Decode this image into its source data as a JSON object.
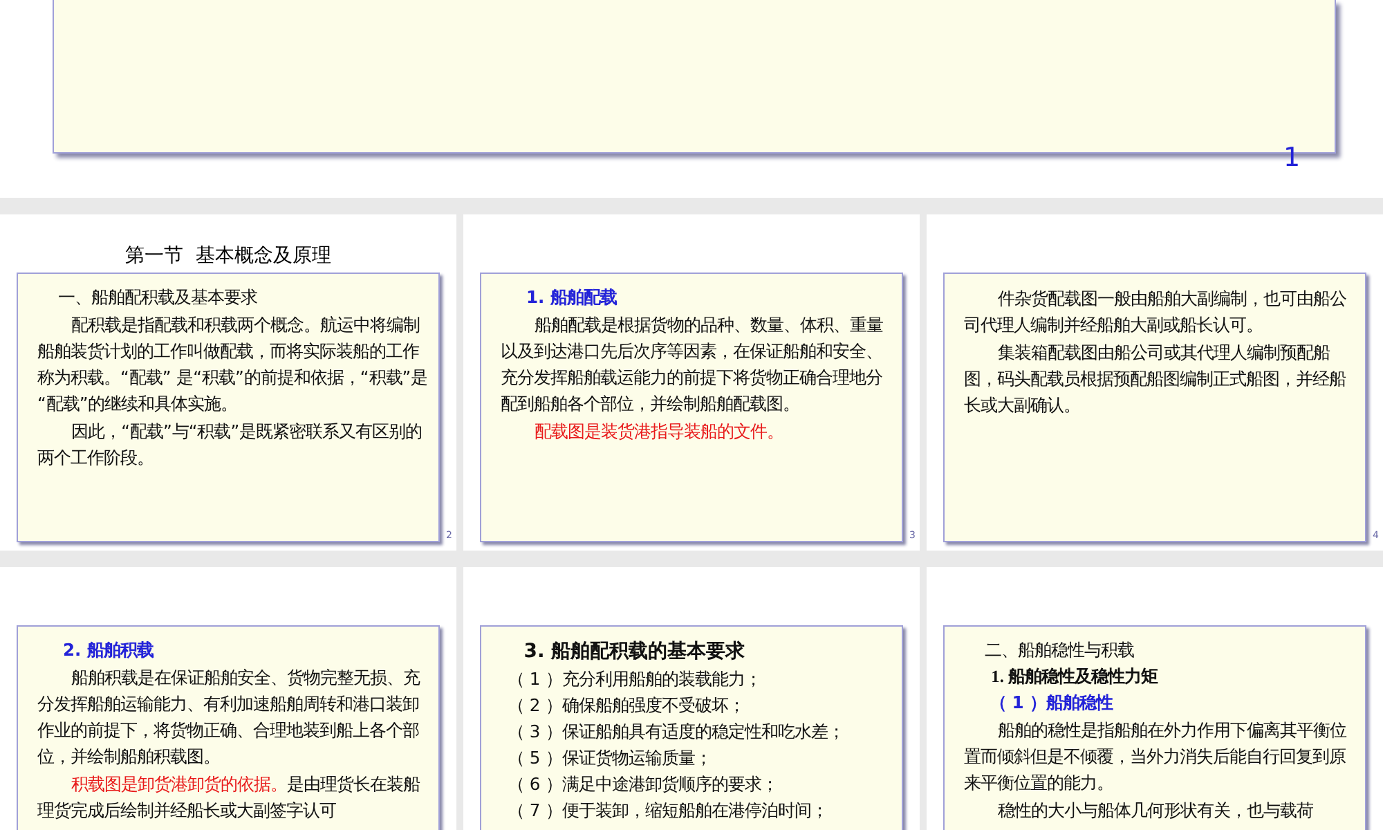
{
  "top_slide": {
    "page_number": "1"
  },
  "slides": [
    {
      "title": "第一节  基本概念及原理",
      "page_number": "2",
      "lines": [
        {
          "kind": "section",
          "text": "一、船舶配积载及基本要求"
        },
        {
          "kind": "para",
          "segments": [
            {
              "text": "配积载是指配载和积载两个概念。航运中将编制船舶装货计划的工作叫做配载，而将实际装船的工作称为积载。“配载” 是“积载”的前提和依据，“积载”是 “配载”的继续和具体实施。",
              "emphasis": false
            }
          ]
        },
        {
          "kind": "para",
          "segments": [
            {
              "text": "因此，“配载”与“积载”是既紧密联系又有区别的两个工作阶段。",
              "emphasis": false
            }
          ]
        }
      ]
    },
    {
      "page_number": "3",
      "lines": [
        {
          "kind": "numbered",
          "text": "1. 船舶配载"
        },
        {
          "kind": "para",
          "segments": [
            {
              "text": "船舶配载是根据货物的品种、数量、体积、重量以及到达港口先后次序等因素，在保证船舶和安全、充分发挥船舶载运能力的前提下将货物正确合理地分配到船舶各个部位，并绘制船舶配载图。",
              "emphasis": false
            }
          ]
        },
        {
          "kind": "para",
          "segments": [
            {
              "text": "配载图是装货港指导装船的文件。",
              "emphasis": true
            }
          ]
        }
      ]
    },
    {
      "page_number": "4",
      "lines": [
        {
          "kind": "para",
          "segments": [
            {
              "text": "件杂货配载图一般由船舶大副编制，也可由船公司代理人编制并经船舶大副或船长认可。",
              "emphasis": false
            }
          ]
        },
        {
          "kind": "para",
          "segments": [
            {
              "text": "集装箱配载图由船公司或其代理人编制预配船图，码头配载员根据预配船图编制正式船图，并经船长或大副确认。",
              "emphasis": false
            }
          ]
        }
      ]
    },
    {
      "lines": [
        {
          "kind": "numbered",
          "text": "2. 船舶积载"
        },
        {
          "kind": "para",
          "segments": [
            {
              "text": "船舶积载是在保证船舶安全、货物完整无损、充分发挥船舶运输能力、有利加速船舶周转和港口装卸作业的前提下，将货物正确、合理地装到船上各个部位，并绘制船舶积载图。",
              "emphasis": false
            }
          ]
        },
        {
          "kind": "para",
          "segments": [
            {
              "text": "积载图是卸货港卸货的依据。",
              "emphasis": true
            },
            {
              "text": "是由理货长在装船理货完成后绘制并经船长或大副签字认可",
              "emphasis": false
            }
          ]
        }
      ]
    },
    {
      "lines": [
        {
          "kind": "heading",
          "text": "3. 船舶配积载的基本要求"
        },
        {
          "kind": "item",
          "text": "（ 1 ）充分利用船舶的装载能力；"
        },
        {
          "kind": "item",
          "text": "（ 2 ）确保船舶强度不受破坏；"
        },
        {
          "kind": "item",
          "text": "（ 3 ）保证船舶具有适度的稳定性和吃水差；"
        },
        {
          "kind": "item",
          "text": "（ 5 ）保证货物运输质量；"
        },
        {
          "kind": "item",
          "text": "（ 6 ）满足中途港卸货顺序的要求；"
        },
        {
          "kind": "item",
          "text": "（ 7 ）便于装卸，缩短船舶在港停泊时间；"
        }
      ]
    },
    {
      "lines": [
        {
          "kind": "section",
          "text": "二、船舶稳性与积载"
        },
        {
          "kind": "sub",
          "text": "1. 船舶稳性及稳性力矩"
        },
        {
          "kind": "numbered",
          "text": "（ 1 ）船舶稳性"
        },
        {
          "kind": "para",
          "segments": [
            {
              "text": "船舶的稳性是指船舶在外力作用下偏离其平衡位置而倾斜但是不倾覆，当外力消失后能自行回复到原来平衡位置的能力。",
              "emphasis": false
            }
          ]
        },
        {
          "kind": "para",
          "segments": [
            {
              "text": "稳性的大小与船体几何形状有关，也与载荷",
              "emphasis": false
            }
          ]
        }
      ]
    }
  ]
}
